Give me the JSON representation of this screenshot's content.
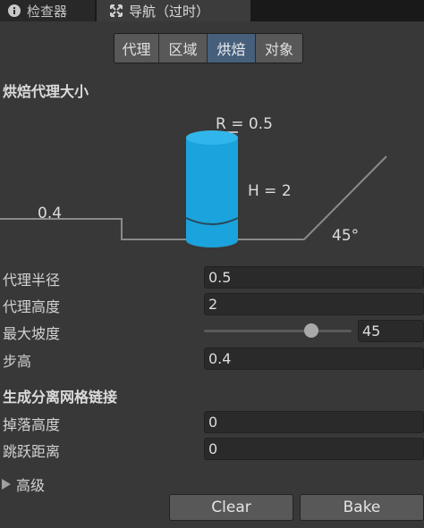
{
  "tabs": [
    {
      "label": "检查器",
      "icon": "info-icon",
      "active": false
    },
    {
      "label": "导航（过时）",
      "icon": "navigation-icon",
      "active": true
    }
  ],
  "segments": [
    {
      "label": "代理",
      "active": false
    },
    {
      "label": "区域",
      "active": false
    },
    {
      "label": "烘焙",
      "active": true
    },
    {
      "label": "对象",
      "active": false
    }
  ],
  "bake_agent_size": {
    "title": "烘焙代理大小",
    "diagram": {
      "radius_label": "R = 0.5",
      "height_label": "H = 2",
      "step_label": "0.4",
      "slope_label": "45°",
      "colors": {
        "agent": "#1aa3dc",
        "agent_top": "#30b6ea",
        "lines": "#8a8a8a"
      }
    },
    "fields": {
      "agent_radius": {
        "label": "代理半径",
        "value": "0.5"
      },
      "agent_height": {
        "label": "代理高度",
        "value": "2"
      },
      "max_slope": {
        "label": "最大坡度",
        "value": "45",
        "slider_min": 0,
        "slider_max": 60,
        "slider_value": 45
      },
      "step_height": {
        "label": "步高",
        "value": "0.4"
      }
    }
  },
  "generated_off_mesh_links": {
    "title": "生成分离网格链接",
    "fields": {
      "drop_height": {
        "label": "掉落高度",
        "value": "0"
      },
      "jump_distance": {
        "label": "跳跃距离",
        "value": "0"
      }
    }
  },
  "advanced": {
    "label": "高级",
    "icon": "foldout-triangle-icon",
    "expanded": false
  },
  "buttons": {
    "clear": "Clear",
    "bake": "Bake"
  }
}
